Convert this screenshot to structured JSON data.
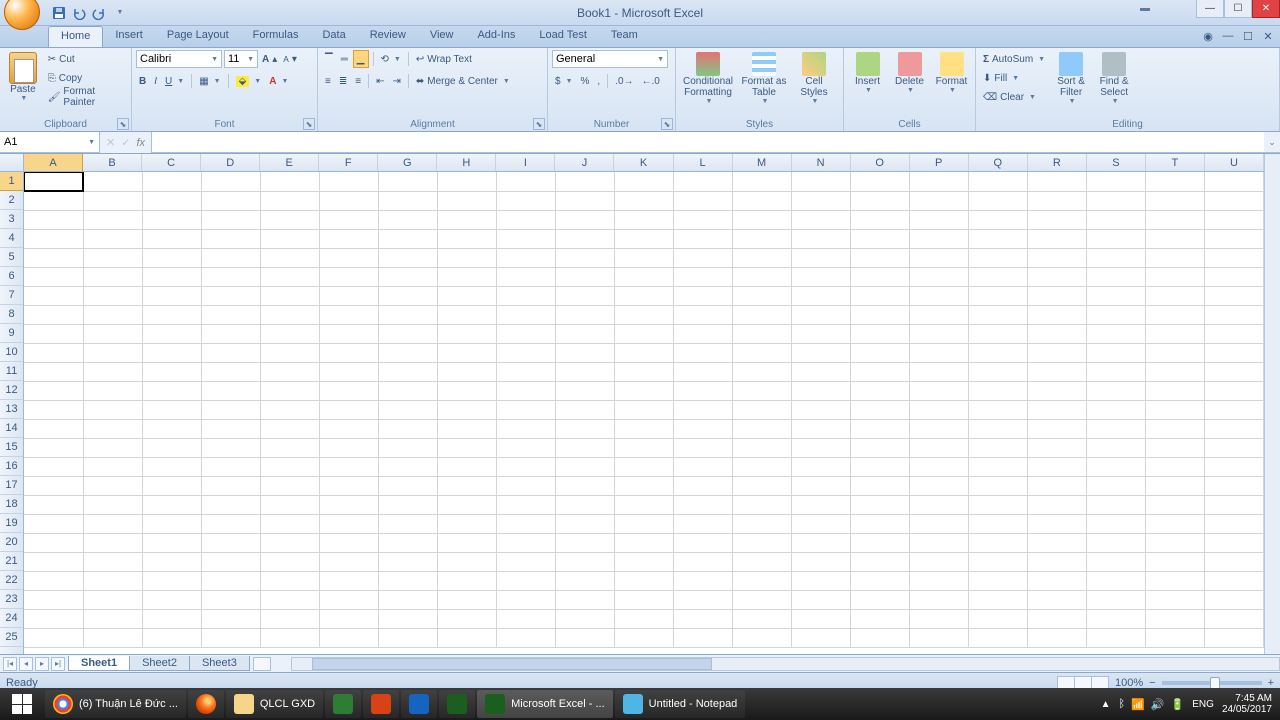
{
  "window": {
    "title": "Book1 - Microsoft Excel"
  },
  "ribbon": {
    "tabs": [
      "Home",
      "Insert",
      "Page Layout",
      "Formulas",
      "Data",
      "Review",
      "View",
      "Add-Ins",
      "Load Test",
      "Team"
    ],
    "active_tab": "Home",
    "clipboard": {
      "label": "Clipboard",
      "paste": "Paste",
      "cut": "Cut",
      "copy": "Copy",
      "format_painter": "Format Painter"
    },
    "font": {
      "label": "Font",
      "name": "Calibri",
      "size": "11"
    },
    "alignment": {
      "label": "Alignment",
      "wrap": "Wrap Text",
      "merge": "Merge & Center"
    },
    "number": {
      "label": "Number",
      "format": "General"
    },
    "styles": {
      "label": "Styles",
      "conditional": "Conditional Formatting",
      "format_table": "Format as Table",
      "cell_styles": "Cell Styles"
    },
    "cells": {
      "label": "Cells",
      "insert": "Insert",
      "delete": "Delete",
      "format": "Format"
    },
    "editing": {
      "label": "Editing",
      "autosum": "AutoSum",
      "fill": "Fill",
      "clear": "Clear",
      "sort": "Sort & Filter",
      "find": "Find & Select"
    }
  },
  "formula_bar": {
    "cell_ref": "A1",
    "fx": "fx"
  },
  "grid": {
    "columns": [
      "A",
      "B",
      "C",
      "D",
      "E",
      "F",
      "G",
      "H",
      "I",
      "J",
      "K",
      "L",
      "M",
      "N",
      "O",
      "P",
      "Q",
      "R",
      "S",
      "T",
      "U"
    ],
    "rows": 25,
    "selected": "A1"
  },
  "sheets": {
    "tabs": [
      "Sheet1",
      "Sheet2",
      "Sheet3"
    ],
    "active": "Sheet1"
  },
  "status": {
    "text": "Ready",
    "zoom": "100%"
  },
  "taskbar": {
    "items": [
      {
        "label": "(6) Thuận Lê Đức ...",
        "color": "#4caf50"
      },
      {
        "label": "",
        "color": "#ff7b29"
      },
      {
        "label": "QLCL GXD",
        "color": "#f4d58a"
      },
      {
        "label": "",
        "color": "#2e7d32"
      },
      {
        "label": "",
        "color": "#d84315"
      },
      {
        "label": "",
        "color": "#1565c0"
      },
      {
        "label": "",
        "color": "#1b5e20"
      },
      {
        "label": "Microsoft Excel - ...",
        "color": "#1b5e20"
      },
      {
        "label": "Untitled - Notepad",
        "color": "#4db6e4"
      }
    ],
    "lang": "ENG",
    "time": "7:45 AM",
    "date": "24/05/2017"
  }
}
